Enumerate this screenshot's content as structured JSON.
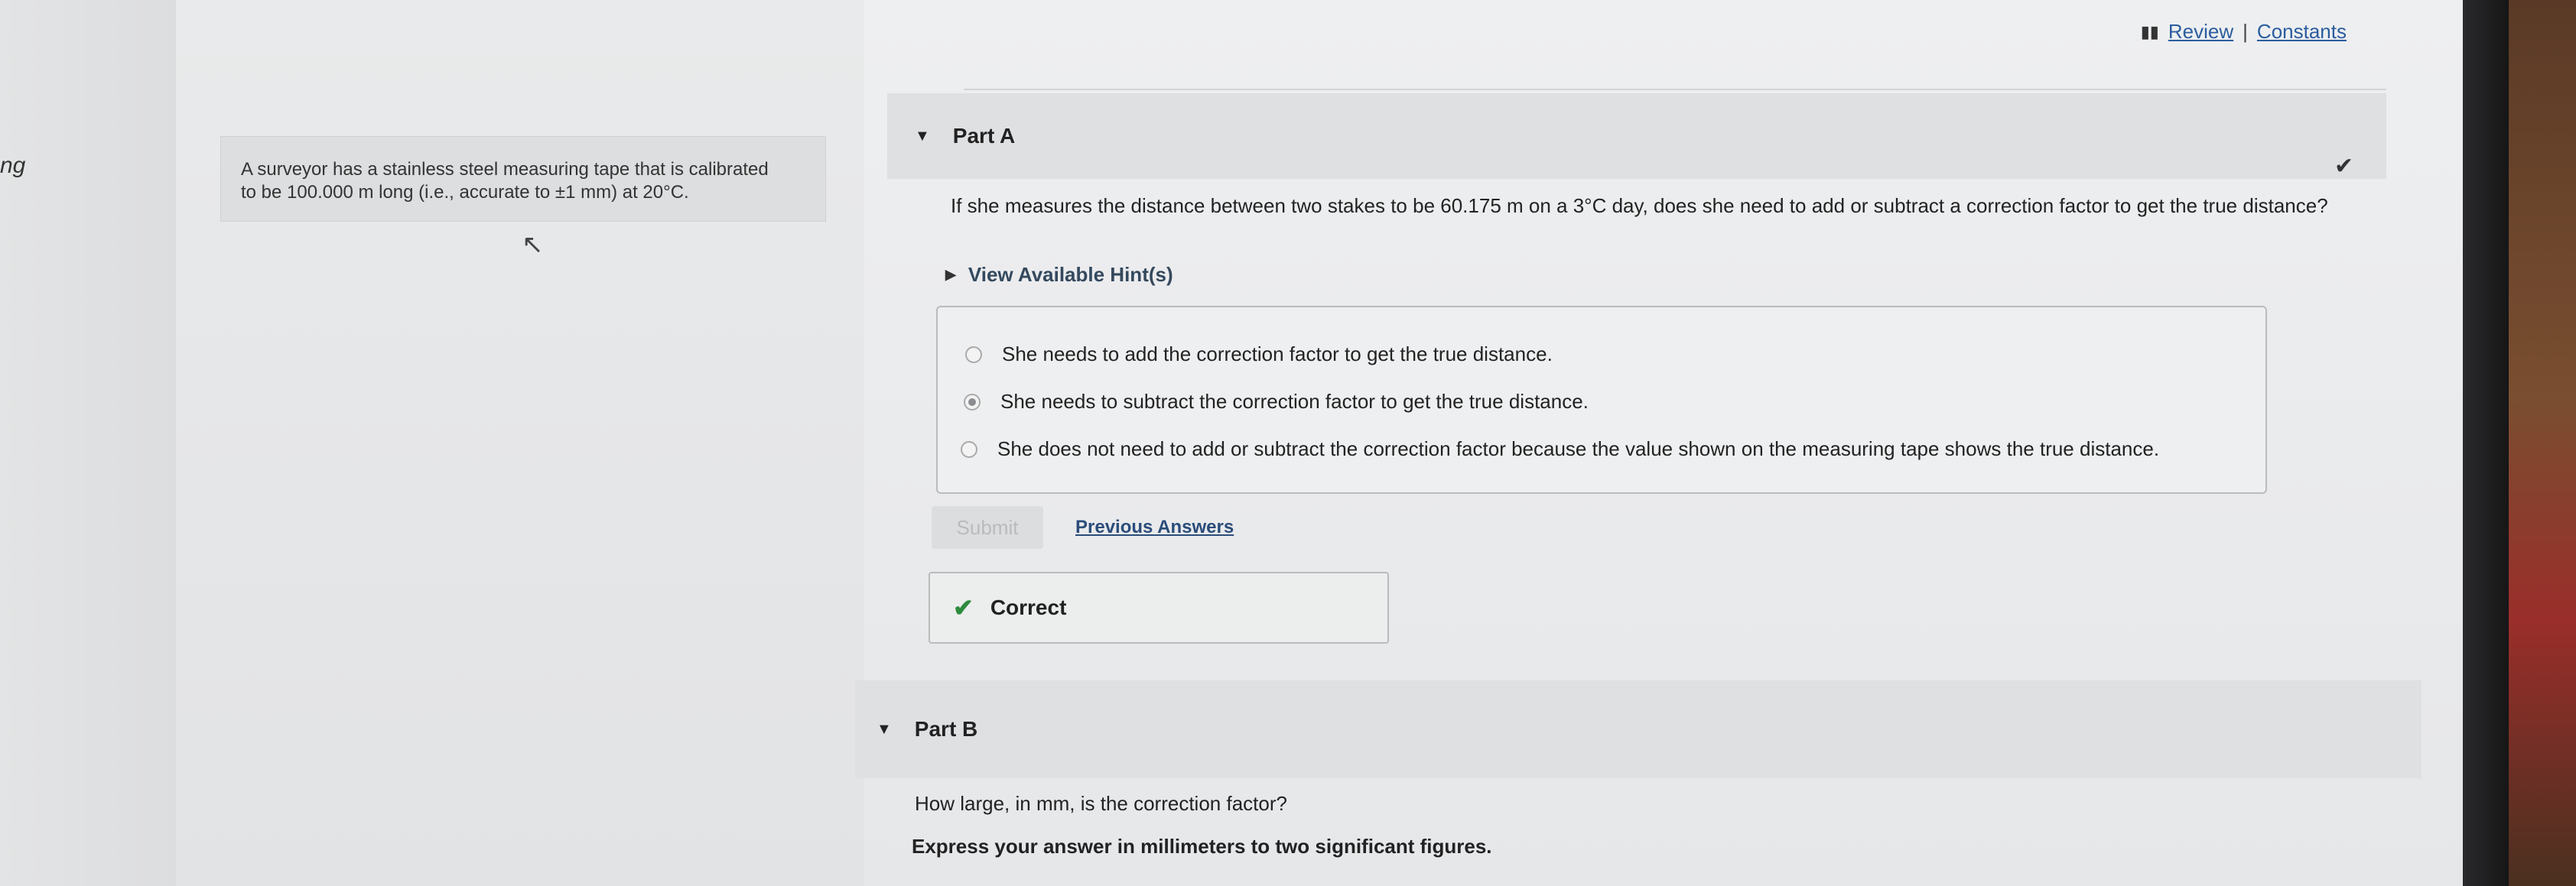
{
  "left_edge_text": "ng",
  "problem": {
    "line1": "A surveyor has a stainless steel measuring tape that is calibrated",
    "line2": "to be 100.000 m long (i.e., accurate to ±1 mm) at 20°C."
  },
  "header_links": {
    "review": "Review",
    "separator": "|",
    "constants": "Constants"
  },
  "part_a": {
    "title": "Part A",
    "question": "If she measures the distance between two stakes to be 60.175 m on a 3°C day, does she need to add or subtract a correction factor to get the true distance?",
    "hints_label": "View Available Hint(s)",
    "options": [
      {
        "label": "She needs to add the correction factor to get the true distance.",
        "selected": false
      },
      {
        "label": "She needs to subtract the correction factor to get the true distance.",
        "selected": true
      },
      {
        "label": "She does not need to add or subtract the correction factor because the value shown on the measuring tape shows the true distance.",
        "selected": false
      }
    ],
    "submit_label": "Submit",
    "previous_answers_label": "Previous Answers",
    "result_label": "Correct"
  },
  "part_b": {
    "title": "Part B",
    "question": "How large, in mm, is the correction factor?",
    "instruction": "Express your answer in millimeters to two significant figures."
  },
  "colors": {
    "link": "#2a5d9f",
    "correct_check": "#2e8b3e",
    "page_bg": "#eeeff0"
  },
  "icons": [
    "book-icon",
    "chevron-down-icon",
    "chevron-right-icon",
    "check-icon"
  ]
}
